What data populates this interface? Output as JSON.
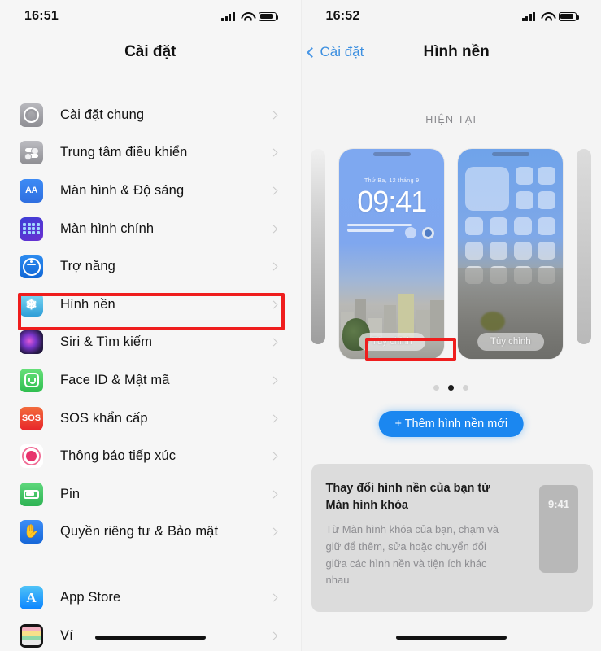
{
  "left": {
    "status": {
      "time": "16:51",
      "signal_icon": "cellular-signal-icon",
      "wifi_icon": "wifi-icon",
      "battery_icon": "battery-icon"
    },
    "nav": {
      "title": "Cài đặt"
    },
    "groups": [
      {
        "items": [
          {
            "label": "Cài đặt chung",
            "icon": "gear-icon",
            "key": "general"
          },
          {
            "label": "Trung tâm điều khiển",
            "icon": "control-center-icon",
            "key": "control-center"
          },
          {
            "label": "Màn hình & Độ sáng",
            "icon": "display-brightness-icon",
            "key": "display",
            "icon_text": "AA"
          },
          {
            "label": "Màn hình chính",
            "icon": "home-screen-icon",
            "key": "home-screen"
          },
          {
            "label": "Trợ năng",
            "icon": "accessibility-icon",
            "key": "accessibility"
          },
          {
            "label": "Hình nền",
            "icon": "wallpaper-icon",
            "key": "wallpaper",
            "highlighted": true
          },
          {
            "label": "Siri & Tìm kiếm",
            "icon": "siri-icon",
            "key": "siri"
          },
          {
            "label": "Face ID & Mật mã",
            "icon": "face-id-icon",
            "key": "face-id"
          },
          {
            "label": "SOS khẩn cấp",
            "icon": "sos-icon",
            "key": "sos",
            "icon_text": "SOS"
          },
          {
            "label": "Thông báo tiếp xúc",
            "icon": "exposure-notification-icon",
            "key": "exposure"
          },
          {
            "label": "Pin",
            "icon": "battery-settings-icon",
            "key": "battery"
          },
          {
            "label": "Quyền riêng tư & Bảo mật",
            "icon": "privacy-hand-icon",
            "key": "privacy"
          }
        ]
      },
      {
        "items": [
          {
            "label": "App Store",
            "icon": "app-store-icon",
            "key": "app-store"
          },
          {
            "label": "Ví",
            "icon": "wallet-icon",
            "key": "wallet"
          }
        ]
      }
    ]
  },
  "right": {
    "status": {
      "time": "16:52",
      "signal_icon": "cellular-signal-icon",
      "wifi_icon": "wifi-icon",
      "battery_icon": "battery-icon"
    },
    "nav": {
      "back_label": "Cài đặt",
      "back_icon": "chevron-left-icon",
      "title": "Hình nền"
    },
    "section_header": "HIỆN TẠI",
    "lock_preview": {
      "clock": "09:41",
      "date": "Thứ Ba, 12 tháng 9",
      "customize_label": "Tùy chỉnh",
      "highlighted": true
    },
    "home_preview": {
      "customize_label": "Tùy chỉnh",
      "highlighted": false
    },
    "pager": {
      "count": 3,
      "active_index": 1
    },
    "add_button": {
      "label": "+ Thêm hình nền mới"
    },
    "info_card": {
      "title": "Thay đổi hình nền của bạn từ Màn hình khóa",
      "body": "Từ Màn hình khóa của bạn, chạm và giữ để thêm, sửa hoặc chuyển đổi giữa các hình nền và tiện ích khác nhau",
      "thumb_time": "9:41"
    }
  },
  "colors": {
    "accent_blue": "#1b87f0",
    "highlight_red": "#ef1d1d",
    "back_link": "#3c8fe0"
  }
}
